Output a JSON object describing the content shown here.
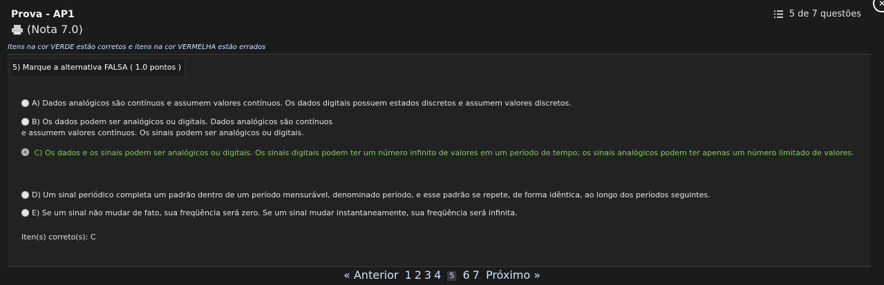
{
  "header": {
    "title": "Prova - AP1",
    "grade": "(Nota 7.0)",
    "question_count": "5 de 7 questões",
    "printer_icon": "printer-icon",
    "list_icon": "list-icon",
    "close_icon": "close-icon"
  },
  "legend": "Itens na cor VERDE estão corretos e itens na cor VERMELHA estão errados",
  "question": {
    "prompt": "5) Marque a alternativa FALSA ( 1.0 pontos )",
    "options": [
      {
        "text": "A) Dados analógicos são contínuos e assumem valores contínuos. Os dados digitais possuem estados discretos e assumem valores discretos."
      },
      {
        "text_line1": "B) Os dados podem ser analógicos ou digitais. Dados analógicos são contínuos",
        "text_line2": "e assumem valores contínuos. Os sinais podem ser analógicos ou digitais."
      },
      {
        "text": "C) Os dados e os sinais podem ser analógicos ou digitais. Os sinais digitais podem ter um número infinito de valores em um período de tempo; os sinais analógicos podem ter apenas um número limitado de valores."
      },
      {
        "text": "D) Um sinal periódico completa um padrão dentro de um período mensurável, denominado período, e esse padrão se repete, de forma idêntica, ao longo dos períodos seguintes."
      },
      {
        "text": "E) Se um sinal não mudar de fato, sua freqüência será zero. Se um sinal mudar instantaneamente, sua freqüência será infinita."
      }
    ],
    "correct_items": "Iten(s) correto(s): C",
    "accent_correct": "#7fcf5a"
  },
  "pager": {
    "prev": "« Anterior",
    "pages": [
      "1",
      "2",
      "3",
      "4",
      "5",
      "6",
      "7"
    ],
    "current": "5",
    "next": "Próximo »"
  }
}
